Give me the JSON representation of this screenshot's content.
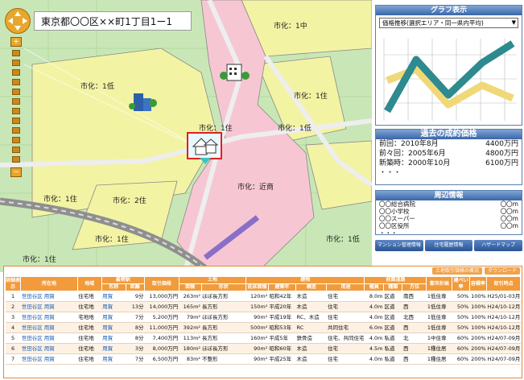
{
  "map": {
    "address": "東京都〇〇区××町1丁目1ー1",
    "zone_labels": [
      {
        "id": "shi1chu",
        "text": "市化：1中"
      },
      {
        "id": "shi1tei_a",
        "text": "市化：1低"
      },
      {
        "id": "shi1ju_a",
        "text": "市化：1住"
      },
      {
        "id": "shi1ju_b",
        "text": "市化：1住"
      },
      {
        "id": "shi1tei_b",
        "text": "市化：1低"
      },
      {
        "id": "shi1ju_c",
        "text": "市化：1住"
      },
      {
        "id": "shi2ju",
        "text": "市化：2住"
      },
      {
        "id": "shikinsho",
        "text": "市化：近商"
      },
      {
        "id": "shi1ju_d",
        "text": "市化：1住"
      },
      {
        "id": "shi1ju_e",
        "text": "市化：1住"
      },
      {
        "id": "shi1tei_c",
        "text": "市化：1低"
      }
    ]
  },
  "graph_panel": {
    "title": "グラフ表示",
    "select_value": "価格推移(選択エリア・同一県内平均)"
  },
  "past_panel": {
    "title": "過去の成約価格",
    "rows": [
      {
        "label": "前回：2010年8月",
        "value": "4400万円"
      },
      {
        "label": "前々回：2005年6月",
        "value": "4800万円"
      },
      {
        "label": "新築時：2000年10月",
        "value": "6100万円"
      }
    ],
    "more": "・・・"
  },
  "around_panel": {
    "title": "周辺情報",
    "rows": [
      {
        "label": "〇〇総合病院",
        "value": "〇〇m"
      },
      {
        "label": "〇〇小学校",
        "value": "〇〇m"
      },
      {
        "label": "〇〇スーパー",
        "value": "〇〇m"
      },
      {
        "label": "〇〇区役所",
        "value": "〇〇m"
      }
    ],
    "more": "・・・"
  },
  "buttons": {
    "mansion": "マンション管理情報",
    "jutaku": "住宅履歴情報",
    "hazard": "ハザードマップ"
  },
  "table": {
    "top_buttons": [
      "土地取引価格の概況",
      "ダウンロード"
    ],
    "headers": [
      "詳細表示",
      "所在地",
      "地域",
      "最寄駅",
      "",
      "取引価格",
      "土地",
      "",
      "",
      "",
      "建物",
      "",
      "",
      "",
      "前面道路",
      "",
      "",
      "",
      "都市計画",
      "建ぺい率",
      "容積率",
      "取引時点"
    ],
    "subheaders": [
      "",
      "",
      "",
      "名称",
      "距離",
      "",
      "面積",
      "形状",
      "",
      "",
      "延床面積",
      "建築年",
      "構造",
      "用途",
      "幅員",
      "種類",
      "方位",
      "",
      "",
      "",
      "",
      ""
    ],
    "rows": [
      {
        "no": "1",
        "loc": "世田谷区 用賀",
        "area": "住宅地",
        "station": "用賀",
        "dist": "9分",
        "price": "13,000万円",
        "land_area": "263m²",
        "shape": "ほぼ長方形",
        "floor": "120m²",
        "year": "昭和42年",
        "struct": "木造",
        "use": "住宅",
        "width": "8.0m",
        "road": "区道",
        "dir": "南西",
        "plan": "1低住専",
        "ken": "50%",
        "yoseki": "100%",
        "date": "H25/01-03月"
      },
      {
        "no": "2",
        "loc": "世田谷区 用賀",
        "area": "住宅地",
        "station": "用賀",
        "dist": "13分",
        "price": "14,000万円",
        "land_area": "165m²",
        "shape": "長方形",
        "floor": "150m²",
        "year": "平成20年",
        "struct": "木造",
        "use": "住宅",
        "width": "4.0m",
        "road": "区道",
        "dir": "西",
        "plan": "1低住専",
        "ken": "50%",
        "yoseki": "100%",
        "date": "H24/10-12月"
      },
      {
        "no": "3",
        "loc": "世田谷区 用賀",
        "area": "宅地地",
        "station": "用賀",
        "dist": "7分",
        "price": "5,200万円",
        "land_area": "79m²",
        "shape": "ほぼ長方形",
        "floor": "90m²",
        "year": "平成19年",
        "struct": "RC、木造",
        "use": "住宅",
        "width": "4.0m",
        "road": "区道",
        "dir": "北西",
        "plan": "1低住専",
        "ken": "50%",
        "yoseki": "100%",
        "date": "H24/10-12月"
      },
      {
        "no": "4",
        "loc": "世田谷区 用賀",
        "area": "住宅地",
        "station": "用賀",
        "dist": "8分",
        "price": "11,000万円",
        "land_area": "392m²",
        "shape": "長方形",
        "floor": "500m²",
        "year": "昭和53年",
        "struct": "RC",
        "use": "共同住宅",
        "width": "6.0m",
        "road": "区道",
        "dir": "西",
        "plan": "1低住専",
        "ken": "50%",
        "yoseki": "100%",
        "date": "H24/10-12月"
      },
      {
        "no": "5",
        "loc": "世田谷区 用賀",
        "area": "住宅地",
        "station": "用賀",
        "dist": "8分",
        "price": "7,400万円",
        "land_area": "113m²",
        "shape": "長方形",
        "floor": "160m²",
        "year": "平成5年",
        "struct": "鉄骨造",
        "use": "住宅、共同住宅",
        "width": "4.0m",
        "road": "私道",
        "dir": "北",
        "plan": "1中住専",
        "ken": "60%",
        "yoseki": "200%",
        "date": "H24/07-09月"
      },
      {
        "no": "6",
        "loc": "世田谷区 用賀",
        "area": "住宅地",
        "station": "用賀",
        "dist": "3分",
        "price": "8,000万円",
        "land_area": "180m²",
        "shape": "ほぼ長方形",
        "floor": "90m²",
        "year": "昭和60年",
        "struct": "木造",
        "use": "住宅",
        "width": "4.5m",
        "road": "私道",
        "dir": "西",
        "plan": "1種住居",
        "ken": "60%",
        "yoseki": "200%",
        "date": "H24/07-09月"
      },
      {
        "no": "7",
        "loc": "世田谷区 用賀",
        "area": "住宅地",
        "station": "用賀",
        "dist": "7分",
        "price": "6,500万円",
        "land_area": "83m²",
        "shape": "不整形",
        "floor": "90m²",
        "year": "平成25年",
        "struct": "木造",
        "use": "住宅",
        "width": "4.0m",
        "road": "私道",
        "dir": "西",
        "plan": "1種住居",
        "ken": "60%",
        "yoseki": "200%",
        "date": "H24/07-09月"
      }
    ]
  },
  "colors": {
    "zone_green": "#c9e7b6",
    "zone_yellow": "#f3f3a4",
    "zone_pink": "#f6c7d3",
    "road": "#eeeeee",
    "rail": "#8f8f8f",
    "marker": "#e02020",
    "table_header": "#f29b3c",
    "panel_header": "#3a66a8"
  }
}
